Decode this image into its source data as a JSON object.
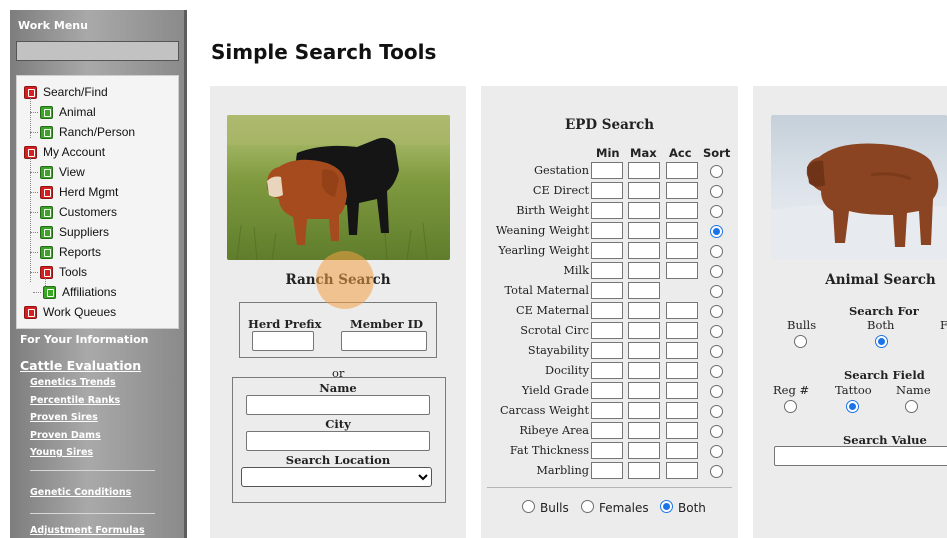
{
  "menu": {
    "title": "Work Menu",
    "items": [
      {
        "label": "Search/Find",
        "color": "red",
        "level": 0
      },
      {
        "label": "Animal",
        "color": "green",
        "level": 1
      },
      {
        "label": "Ranch/Person",
        "color": "green",
        "level": 1
      },
      {
        "label": "My Account",
        "color": "red",
        "level": 0
      },
      {
        "label": "View",
        "color": "green",
        "level": 1
      },
      {
        "label": "Herd Mgmt",
        "color": "red",
        "level": 1
      },
      {
        "label": "Customers",
        "color": "green",
        "level": 1
      },
      {
        "label": "Suppliers",
        "color": "green",
        "level": 1
      },
      {
        "label": "Reports",
        "color": "green",
        "level": 1
      },
      {
        "label": "Tools",
        "color": "red",
        "level": 1
      },
      {
        "label": "Affiliations",
        "color": "green",
        "level": 2
      },
      {
        "label": "Work Queues",
        "color": "red",
        "level": 0
      }
    ],
    "info_heading": "For Your Information",
    "section_title": "Cattle Evaluation",
    "links": [
      "Genetics Trends",
      "Percentile Ranks",
      "Proven Sires",
      "Proven Dams",
      "Young Sires"
    ],
    "links2": [
      "Genetic Conditions",
      "Adjustment Formulas"
    ]
  },
  "page": {
    "title": "Simple Search Tools"
  },
  "ranch": {
    "heading": "Ranch Search",
    "herd_prefix_label": "Herd Prefix",
    "member_id_label": "Member ID",
    "or_label": "or",
    "name_label": "Name",
    "city_label": "City",
    "location_label": "Search Location",
    "location_value": ""
  },
  "epd": {
    "heading": "EPD Search",
    "columns": [
      "Min",
      "Max",
      "Acc",
      "Sort"
    ],
    "traits": [
      {
        "label": "Gestation",
        "acc": true,
        "sorted": false
      },
      {
        "label": "CE Direct",
        "acc": true,
        "sorted": false
      },
      {
        "label": "Birth Weight",
        "acc": true,
        "sorted": false
      },
      {
        "label": "Weaning Weight",
        "acc": true,
        "sorted": true
      },
      {
        "label": "Yearling Weight",
        "acc": true,
        "sorted": false
      },
      {
        "label": "Milk",
        "acc": true,
        "sorted": false
      },
      {
        "label": "Total Maternal",
        "acc": false,
        "sorted": false
      },
      {
        "label": "CE Maternal",
        "acc": true,
        "sorted": false
      },
      {
        "label": "Scrotal Circ",
        "acc": true,
        "sorted": false
      },
      {
        "label": "Stayability",
        "acc": true,
        "sorted": false
      },
      {
        "label": "Docility",
        "acc": true,
        "sorted": false
      },
      {
        "label": "Yield Grade",
        "acc": true,
        "sorted": false
      },
      {
        "label": "Carcass Weight",
        "acc": true,
        "sorted": false
      },
      {
        "label": "Ribeye Area",
        "acc": true,
        "sorted": false
      },
      {
        "label": "Fat Thickness",
        "acc": true,
        "sorted": false
      },
      {
        "label": "Marbling",
        "acc": true,
        "sorted": false
      }
    ],
    "gender_options": [
      {
        "label": "Bulls",
        "selected": false
      },
      {
        "label": "Females",
        "selected": false
      },
      {
        "label": "Both",
        "selected": true
      }
    ]
  },
  "animal": {
    "heading": "Animal Search",
    "search_for_label": "Search For",
    "search_for_options": [
      {
        "label": "Bulls",
        "selected": false
      },
      {
        "label": "Both",
        "selected": true
      },
      {
        "label": "F",
        "selected": false
      }
    ],
    "search_field_label": "Search Field",
    "search_field_options": [
      {
        "label": "Reg #",
        "selected": false
      },
      {
        "label": "Tattoo",
        "selected": true
      },
      {
        "label": "Name",
        "selected": false
      }
    ],
    "search_value_label": "Search Value"
  },
  "colors": {
    "accent": "#1a73e8",
    "menu_red": "#d62020",
    "menu_green": "#3ba526",
    "panel_bg": "#ececec"
  }
}
